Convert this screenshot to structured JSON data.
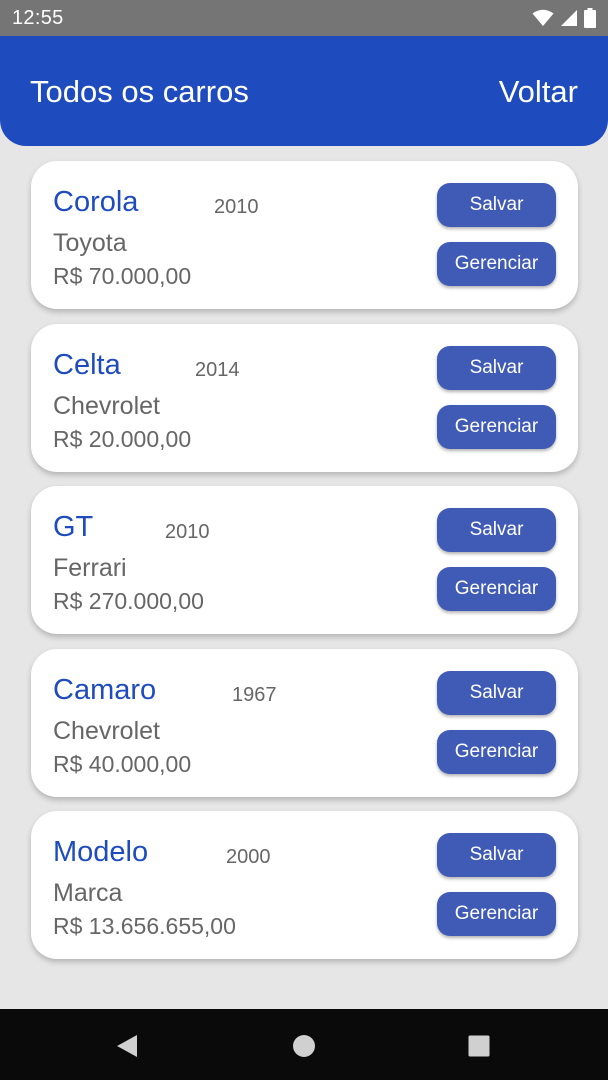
{
  "status_bar": {
    "time": "12:55",
    "icons": [
      "wifi-icon",
      "cellular-signal-icon",
      "battery-icon"
    ]
  },
  "app_bar": {
    "title": "Todos os carros",
    "back_label": "Voltar",
    "color": "#1e4bbd"
  },
  "cars": [
    {
      "model": "Corola",
      "year": "2010",
      "brand": "Toyota",
      "price": "R$ 70.000,00",
      "save_label": "Salvar",
      "manage_label": "Gerenciar"
    },
    {
      "model": "Celta",
      "year": "2014",
      "brand": "Chevrolet",
      "price": "R$ 20.000,00",
      "save_label": "Salvar",
      "manage_label": "Gerenciar"
    },
    {
      "model": "GT",
      "year": "2010",
      "brand": "Ferrari",
      "price": "R$ 270.000,00",
      "save_label": "Salvar",
      "manage_label": "Gerenciar"
    },
    {
      "model": "Camaro",
      "year": "1967",
      "brand": "Chevrolet",
      "price": "R$ 40.000,00",
      "save_label": "Salvar",
      "manage_label": "Gerenciar"
    },
    {
      "model": "Modelo",
      "year": "2000",
      "brand": "Marca",
      "price": "R$ 13.656.655,00",
      "save_label": "Salvar",
      "manage_label": "Gerenciar"
    }
  ],
  "nav_bar": {
    "icons": [
      "back-triangle-icon",
      "home-circle-icon",
      "recents-square-icon"
    ]
  }
}
